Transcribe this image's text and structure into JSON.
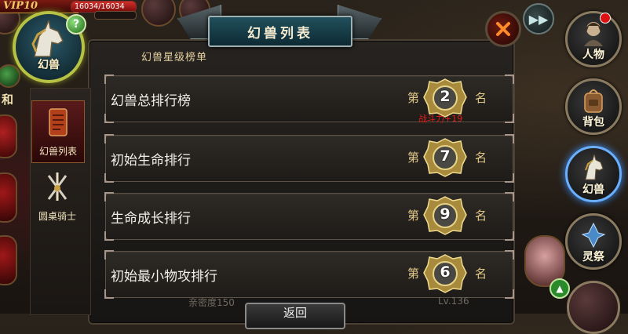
{
  "hud": {
    "vip_label": "VIP10",
    "hp_text": "16034/16034",
    "hp_fraction": 1.0,
    "help_glyph": "?",
    "avatar_label": "幻兽",
    "left_edge_label": "和"
  },
  "panel": {
    "title": "幻兽列表",
    "section_title": "幻兽星级榜单"
  },
  "side_tabs": [
    {
      "label": "幻兽列表",
      "icon": "scroll-icon",
      "active": true
    },
    {
      "label": "圆桌骑士",
      "icon": "swords-icon",
      "active": false
    }
  ],
  "rankings": [
    {
      "label": "幻兽总排行榜",
      "prefix": "第",
      "rank": "2",
      "suffix": "名",
      "power": "战斗力+19"
    },
    {
      "label": "初始生命排行",
      "prefix": "第",
      "rank": "7",
      "suffix": "名",
      "power": ""
    },
    {
      "label": "生命成长排行",
      "prefix": "第",
      "rank": "9",
      "suffix": "名",
      "power": ""
    },
    {
      "label": "初始最小物攻排行",
      "prefix": "第",
      "rank": "6",
      "suffix": "名",
      "power": ""
    }
  ],
  "right_nav": [
    {
      "label": "人物",
      "icon": "character-icon",
      "active": false
    },
    {
      "label": "背包",
      "icon": "backpack-icon",
      "active": false
    },
    {
      "label": "幻兽",
      "icon": "unicorn-icon",
      "active": true
    },
    {
      "label": "灵祭",
      "icon": "spirit-icon",
      "active": false
    }
  ],
  "bottom": {
    "back_label": "返回",
    "ghost_left": "亲密度150",
    "ghost_right": "Lv.136"
  },
  "colors": {
    "power_red": "#e0201a",
    "rank_gold": "#e3c98a",
    "active_nav_glow": "#3a90ff"
  }
}
